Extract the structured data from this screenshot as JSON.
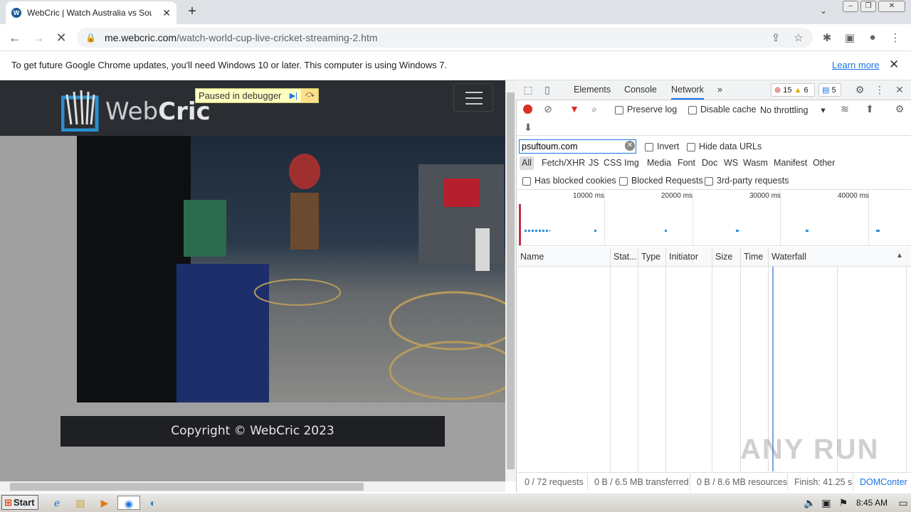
{
  "browser": {
    "tab_title": "WebCric | Watch Australia vs South",
    "favicon_letter": "W",
    "url_domain": "me.webcric.com",
    "url_path": "/watch-world-cup-live-cricket-streaming-2.htm",
    "infobar_text": "To get future Google Chrome updates, you'll need Windows 10 or later. This computer is using Windows 7.",
    "learn_more": "Learn more"
  },
  "page": {
    "logo_text_light": "Web",
    "logo_text_bold": "Cric",
    "debugger_text": "Paused in debugger",
    "copyright": "Copyright © WebCric 2023"
  },
  "devtools": {
    "tabs": [
      "Elements",
      "Console",
      "Network"
    ],
    "more": "»",
    "errors": "15",
    "warnings": "6",
    "messages": "5",
    "preserve_log": "Preserve log",
    "disable_cache": "Disable cache",
    "throttling": "No throttling",
    "filter_value": "psuftoum.com",
    "invert": "Invert",
    "hide_data_urls": "Hide data URLs",
    "types": [
      "All",
      "Fetch/XHR",
      "JS",
      "CSS",
      "Img",
      "Media",
      "Font",
      "Doc",
      "WS",
      "Wasm",
      "Manifest",
      "Other"
    ],
    "has_blocked_cookies": "Has blocked cookies",
    "blocked_requests": "Blocked Requests",
    "third_party": "3rd-party requests",
    "overview_labels": [
      "10000 ms",
      "20000 ms",
      "30000 ms",
      "40000 ms"
    ],
    "columns": [
      "Name",
      "Stat...",
      "Type",
      "Initiator",
      "Size",
      "Time",
      "Waterfall"
    ],
    "status_requests": "0 / 72 requests",
    "status_transferred": "0 B / 6.5 MB transferred",
    "status_resources": "0 B / 8.6 MB resources",
    "status_finish": "Finish: 41.25 s",
    "status_dom": "DOMConter"
  },
  "taskbar": {
    "start": "Start",
    "clock": "8:45 AM"
  },
  "watermark": "ANY RUN"
}
